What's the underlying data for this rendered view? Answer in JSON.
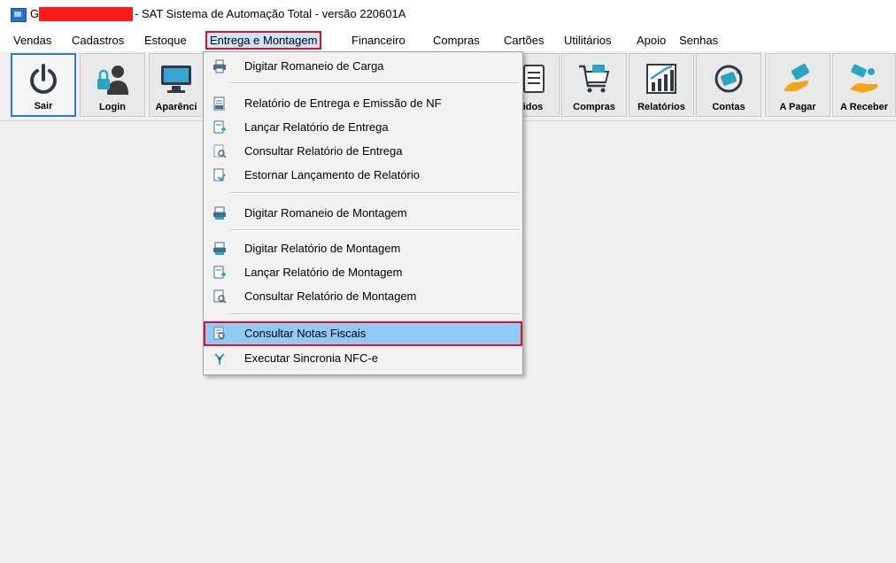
{
  "window": {
    "title_prefix": "G",
    "title": "- SAT Sistema de Automação Total - versão 220601A"
  },
  "menubar": [
    {
      "label": "Vendas"
    },
    {
      "label": "Cadastros"
    },
    {
      "label": "Estoque"
    },
    {
      "label": "Entrega e Montagem"
    },
    {
      "label": "Financeiro"
    },
    {
      "label": "Compras"
    },
    {
      "label": "Cartões"
    },
    {
      "label": "Utilitários"
    },
    {
      "label": "Apoio"
    },
    {
      "label": "Senhas"
    }
  ],
  "toolbar": [
    {
      "label": "Sair",
      "icon": "power-icon"
    },
    {
      "label": "Login",
      "icon": "user-lock-icon"
    },
    {
      "label": "Aparênci",
      "icon": "monitor-icon"
    },
    {
      "label": "idos",
      "icon": "clipboard-icon"
    },
    {
      "label": "Compras",
      "icon": "cart-icon"
    },
    {
      "label": "Relatórios",
      "icon": "bar-chart-icon"
    },
    {
      "label": "Contas",
      "icon": "money-cycle-icon"
    },
    {
      "label": "A Pagar",
      "icon": "pay-hand-icon"
    },
    {
      "label": "A Receber",
      "icon": "receive-hand-icon"
    }
  ],
  "dropdown": {
    "items": [
      {
        "label": "Digitar Romaneio de Carga",
        "icon": "printer-icon"
      },
      {
        "label": "Relatório de Entrega e Emissão de NF",
        "icon": "report-icon"
      },
      {
        "label": "Lançar Relatório de Entrega",
        "icon": "report-add-icon"
      },
      {
        "label": "Consultar Relatório de Entrega",
        "icon": "report-search-icon"
      },
      {
        "label": "Estornar Lançamento de Relatório",
        "icon": "report-undo-icon"
      },
      {
        "label": "Digitar Romaneio de Montagem",
        "icon": "assembly-icon"
      },
      {
        "label": "Digitar Relatório de Montagem",
        "icon": "assembly-report-icon"
      },
      {
        "label": "Lançar Relatório de Montagem",
        "icon": "report-add-icon"
      },
      {
        "label": "Consultar Relatório de Montagem",
        "icon": "report-search-icon"
      },
      {
        "label": "Consultar Notas Fiscais",
        "icon": "invoice-search-icon"
      },
      {
        "label": "Executar Sincronia NFC-e",
        "icon": "sync-icon"
      }
    ]
  },
  "colors": {
    "highlight_outline": "#e0102a",
    "menu_hover": "#91c9f7",
    "selected_button_border": "#2d7bd4"
  }
}
